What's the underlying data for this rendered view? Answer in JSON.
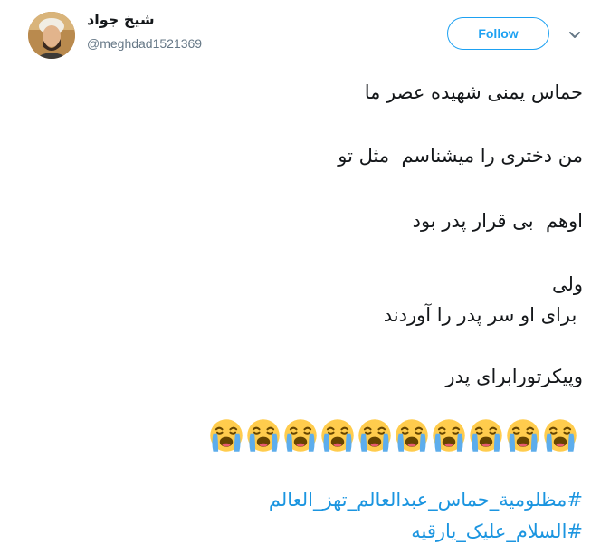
{
  "tweet": {
    "author": {
      "display_name": "شیخ جواد",
      "handle": "@meghdad1521369",
      "avatar_icon": "user-avatar"
    },
    "follow_label": "Follow",
    "menu_icon": "chevron-down-icon",
    "lines": [
      "حماس یمنی شهیده عصر ما",
      "من دختری را میشناسم  مثل تو",
      "اوهم  بی قرار پدر بود",
      "ولی",
      " برای او سر پدر را آوردند",
      "وپیکرتورابرای پدر"
    ],
    "emoji": {
      "name": "loudly-crying-face",
      "count": 10
    },
    "hashtags": [
      "#مظلومية_حماس_عبدالعالم_تهز_العالم",
      "#السلام_علیک_یارقیه"
    ]
  },
  "colors": {
    "accent": "#1da1f2",
    "hashtag": "#1b95e0",
    "text": "#14171a",
    "muted": "#657786",
    "emoji_face": "#ffcc4d",
    "emoji_tears": "#5dadec"
  }
}
